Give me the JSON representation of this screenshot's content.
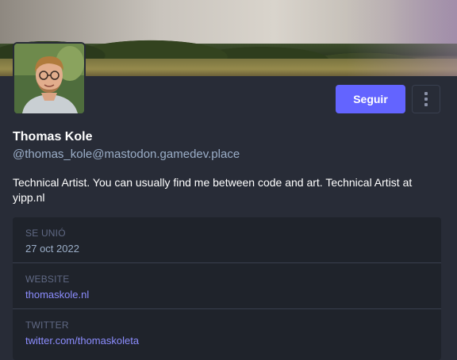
{
  "profile": {
    "display_name": "Thomas Kole",
    "handle": "@thomas_kole@mastodon.gamedev.place",
    "bio": "Technical Artist. You can usually find me between code and art. Technical Artist at yipp.nl"
  },
  "actions": {
    "follow_label": "Seguir",
    "menu_icon": "kebab-menu-icon"
  },
  "fields": [
    {
      "label": "SE UNIÓ",
      "value": "27 oct 2022"
    },
    {
      "label": "WEBSITE",
      "value": "thomaskole.nl"
    },
    {
      "label": "TWITTER",
      "value": "twitter.com/thomaskoleta"
    }
  ],
  "colors": {
    "background": "#282c37",
    "accent": "#6364ff",
    "secondary_text": "#9baec8",
    "field_label": "#606984",
    "field_background": "#1f232b"
  }
}
